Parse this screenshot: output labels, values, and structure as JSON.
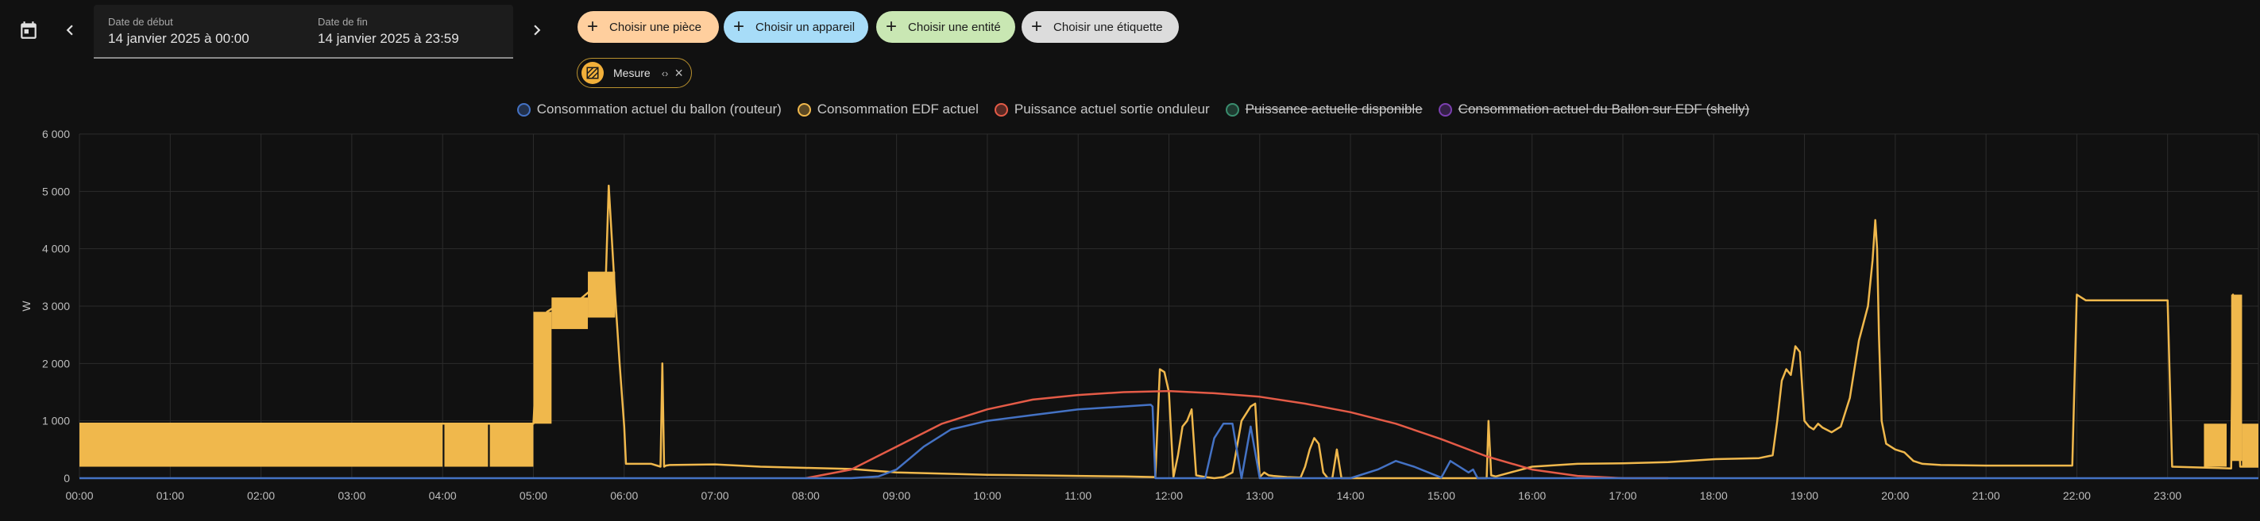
{
  "toolbar": {
    "calendar_icon": "calendar-icon",
    "prev_icon": "chevron-left-icon",
    "next_icon": "chevron-right-icon",
    "start_label": "Date de début",
    "start_value": "14 janvier 2025 à 00:00",
    "end_label": "Date de fin",
    "end_value": "14 janvier 2025 à 23:59"
  },
  "targets": {
    "room": "Choisir une pièce",
    "device": "Choisir un appareil",
    "entity": "Choisir une entité",
    "label": "Choisir une étiquette"
  },
  "selected": {
    "label": "Mesure",
    "expand": "‹›",
    "remove": "×"
  },
  "colors": {
    "room": "#ffcf9e",
    "device": "#a7dcf8",
    "entity": "#c9e7b3",
    "label": "#dcdcdc",
    "routeur": "#4472c4",
    "edf": "#f0b84c",
    "onduleur": "#e45b47",
    "disponible": "#3a8d6e",
    "shelly": "#7b3fb0"
  },
  "chart_data": {
    "type": "line",
    "ylabel": "W",
    "ylim": [
      0,
      6000
    ],
    "yticks": [
      "0",
      "1 000",
      "2 000",
      "3 000",
      "4 000",
      "5 000",
      "6 000"
    ],
    "xticks": [
      "00:00",
      "01:00",
      "02:00",
      "03:00",
      "04:00",
      "05:00",
      "06:00",
      "07:00",
      "08:00",
      "09:00",
      "10:00",
      "11:00",
      "12:00",
      "13:00",
      "14:00",
      "15:00",
      "16:00",
      "17:00",
      "18:00",
      "19:00",
      "20:00",
      "21:00",
      "22:00",
      "23:00"
    ],
    "legend": [
      {
        "name": "Consommation actuel du ballon (routeur)",
        "color": "#4472c4",
        "hidden": false
      },
      {
        "name": "Consommation EDF actuel",
        "color": "#f0b84c",
        "hidden": false
      },
      {
        "name": "Puissance actuel sortie onduleur",
        "color": "#e45b47",
        "hidden": false
      },
      {
        "name": "Puissance actuelle disponible",
        "color": "#3a8d6e",
        "hidden": true
      },
      {
        "name": "Consommation actuel du Ballon sur EDF (shelly)",
        "color": "#7b3fb0",
        "hidden": true
      }
    ],
    "series": [
      {
        "name": "Consommation EDF actuel",
        "color": "#f0b84c",
        "fill_bands": [
          {
            "x0": 0.0,
            "x1": 4.0,
            "low": 200,
            "high": 950
          },
          {
            "x0": 4.02,
            "x1": 4.5,
            "low": 200,
            "high": 950
          },
          {
            "x0": 4.52,
            "x1": 5.0,
            "low": 200,
            "high": 950
          },
          {
            "x0": 5.0,
            "x1": 5.2,
            "low": 950,
            "high": 2900
          },
          {
            "x0": 5.2,
            "x1": 5.6,
            "low": 2600,
            "high": 3150
          },
          {
            "x0": 5.6,
            "x1": 5.9,
            "low": 2800,
            "high": 3600
          },
          {
            "x0": 23.4,
            "x1": 23.65,
            "low": 200,
            "high": 950
          },
          {
            "x0": 23.7,
            "x1": 23.82,
            "low": 300,
            "high": 3200
          },
          {
            "x0": 23.82,
            "x1": 24.0,
            "low": 200,
            "high": 950
          }
        ],
        "x": [
          0,
          5.0,
          5.05,
          5.15,
          5.3,
          5.5,
          5.65,
          5.75,
          5.8,
          5.83,
          5.9,
          5.95,
          6.0,
          6.02,
          6.3,
          6.4,
          6.42,
          6.44,
          6.46,
          6.5,
          7.0,
          7.5,
          8.0,
          8.5,
          9.0,
          9.5,
          10.0,
          10.5,
          11.0,
          11.5,
          11.85,
          11.9,
          11.95,
          12.0,
          12.05,
          12.1,
          12.15,
          12.2,
          12.25,
          12.3,
          12.4,
          12.5,
          12.6,
          12.7,
          12.8,
          12.9,
          12.95,
          13.0,
          13.05,
          13.1,
          13.15,
          13.3,
          13.45,
          13.5,
          13.55,
          13.6,
          13.65,
          13.7,
          13.75,
          13.8,
          13.85,
          13.9,
          14.0,
          14.5,
          15.0,
          15.4,
          15.5,
          15.52,
          15.55,
          15.6,
          16.0,
          16.5,
          17.0,
          17.5,
          18.0,
          18.5,
          18.65,
          18.7,
          18.75,
          18.8,
          18.85,
          18.9,
          18.95,
          19.0,
          19.05,
          19.1,
          19.15,
          19.2,
          19.3,
          19.4,
          19.5,
          19.6,
          19.7,
          19.75,
          19.78,
          19.8,
          19.82,
          19.85,
          19.9,
          19.95,
          20.0,
          20.1,
          20.2,
          20.3,
          20.5,
          21.0,
          21.5,
          21.95,
          22.0,
          22.05,
          22.1,
          22.5,
          22.95,
          23.0,
          23.05,
          23.5,
          23.7,
          23.72,
          23.8,
          23.82,
          24.0
        ],
        "values": [
          950,
          950,
          2400,
          2900,
          3050,
          3100,
          3300,
          3500,
          3600,
          5100,
          3200,
          2000,
          900,
          250,
          250,
          200,
          2000,
          200,
          220,
          230,
          240,
          200,
          180,
          160,
          100,
          80,
          60,
          50,
          40,
          30,
          20,
          1900,
          1850,
          1500,
          20,
          400,
          900,
          1000,
          1200,
          50,
          20,
          0,
          20,
          100,
          1000,
          1250,
          1300,
          20,
          100,
          50,
          40,
          20,
          10,
          200,
          500,
          700,
          600,
          100,
          0,
          0,
          500,
          0,
          0,
          0,
          0,
          0,
          0,
          1000,
          50,
          30,
          200,
          250,
          260,
          280,
          330,
          350,
          400,
          1000,
          1700,
          1900,
          1800,
          2300,
          2200,
          1000,
          900,
          850,
          950,
          880,
          800,
          900,
          1400,
          2400,
          3000,
          3800,
          4500,
          4000,
          2500,
          1000,
          600,
          550,
          500,
          450,
          300,
          250,
          230,
          220,
          220,
          220,
          3200,
          3150,
          3100,
          3100,
          3100,
          3100,
          200,
          180,
          170,
          3200,
          200,
          200,
          200
        ]
      },
      {
        "name": "Puissance actuel sortie onduleur",
        "color": "#e45b47",
        "x": [
          8.0,
          8.5,
          9.0,
          9.5,
          10.0,
          10.5,
          11.0,
          11.5,
          12.0,
          12.5,
          13.0,
          13.5,
          14.0,
          14.5,
          15.0,
          15.5,
          16.0,
          16.5,
          17.0,
          17.5
        ],
        "values": [
          0,
          150,
          550,
          950,
          1200,
          1370,
          1450,
          1500,
          1520,
          1480,
          1420,
          1300,
          1150,
          950,
          680,
          380,
          150,
          40,
          0,
          0
        ]
      },
      {
        "name": "Consommation actuel du ballon (routeur)",
        "color": "#4472c4",
        "x": [
          0,
          8.5,
          8.8,
          9.0,
          9.3,
          9.6,
          10.0,
          10.5,
          11.0,
          11.5,
          11.8,
          11.82,
          11.85,
          11.9,
          12.0,
          12.2,
          12.4,
          12.5,
          12.6,
          12.7,
          12.8,
          12.9,
          13.0,
          13.1,
          13.2,
          13.5,
          14.0,
          14.3,
          14.5,
          14.7,
          15.0,
          15.1,
          15.2,
          15.3,
          15.35,
          15.4,
          15.5,
          15.6,
          24.0
        ],
        "values": [
          0,
          0,
          30,
          150,
          550,
          850,
          1000,
          1100,
          1200,
          1250,
          1280,
          1250,
          0,
          0,
          0,
          0,
          0,
          700,
          950,
          950,
          0,
          900,
          0,
          0,
          0,
          0,
          0,
          150,
          300,
          200,
          10,
          300,
          200,
          100,
          150,
          0,
          0,
          0,
          0
        ]
      }
    ]
  }
}
